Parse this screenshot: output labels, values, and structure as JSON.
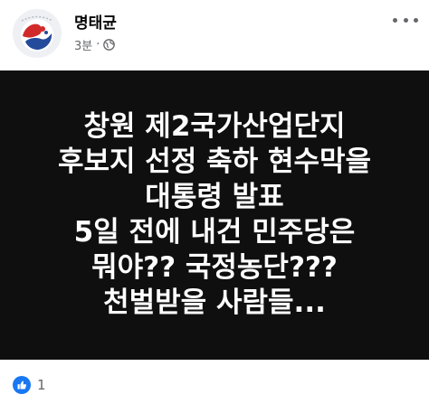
{
  "post": {
    "author": "명태균",
    "time": "3분",
    "separator": "·",
    "privacy_icon": "globe-icon",
    "more_icon": "more-options-icon",
    "image_text": {
      "lines": [
        "창원 제2국가산업단지",
        "후보지 선정 축하 현수막을",
        "대통령 발표",
        "5일 전에 내건 민주당은",
        "뭐야??  국정농단???",
        "천벌받을 사람들..."
      ],
      "background": "#0f0f0f",
      "text_color": "#ffffff"
    },
    "reactions": {
      "icon": "like-icon",
      "count": "1",
      "color": "#1877f2"
    }
  }
}
